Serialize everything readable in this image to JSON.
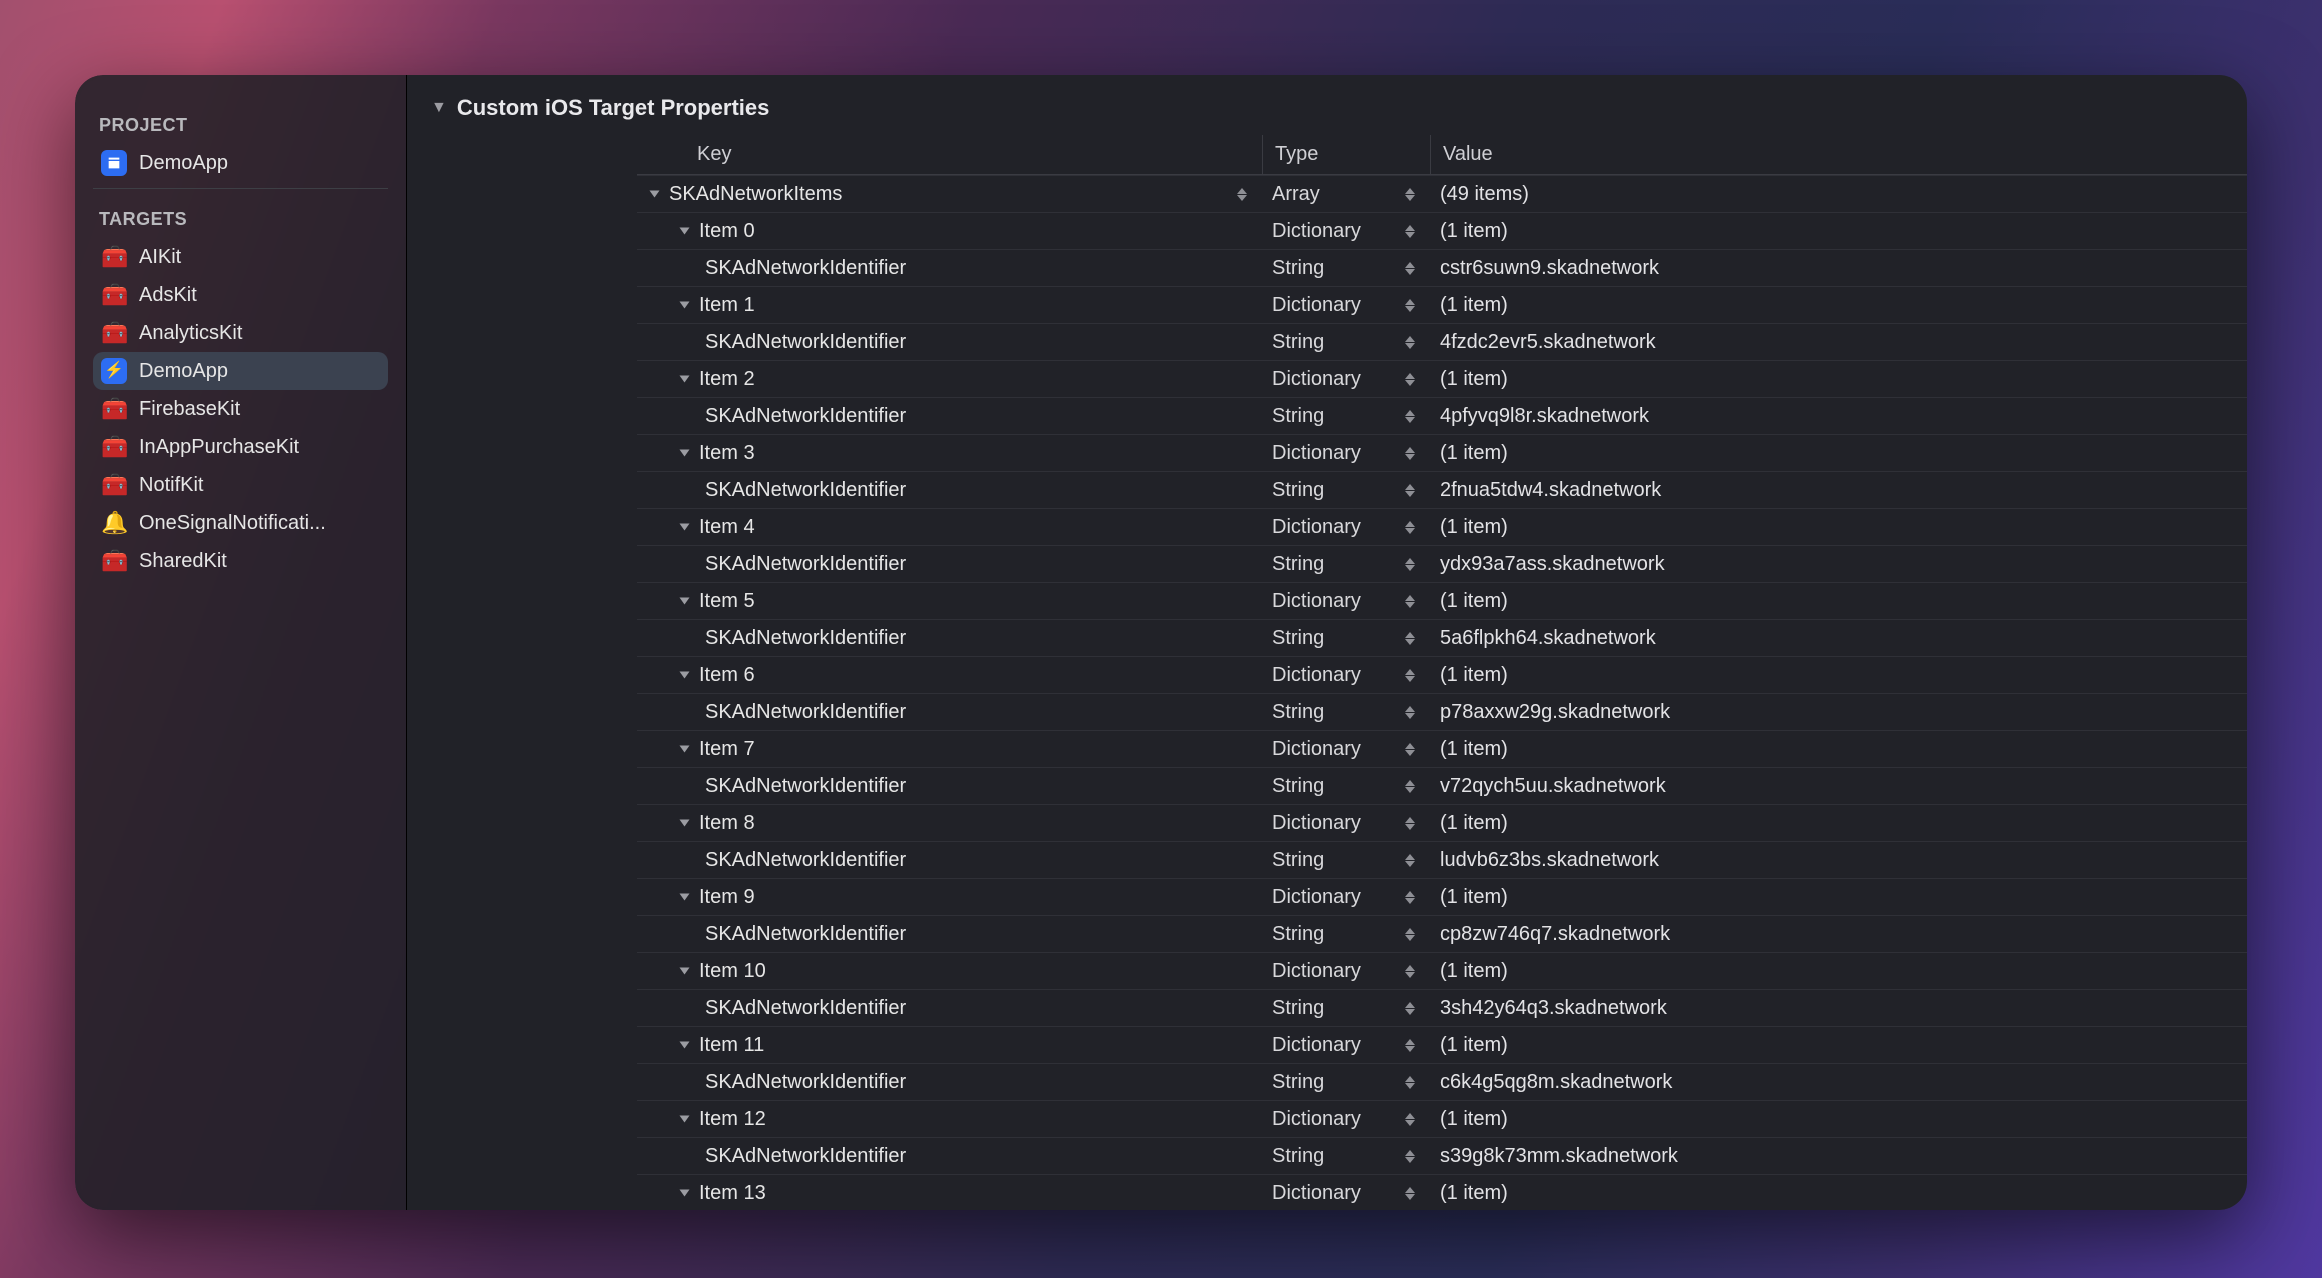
{
  "sidebar": {
    "sections": {
      "project": {
        "title": "PROJECT"
      },
      "targets": {
        "title": "TARGETS"
      }
    },
    "project_item": {
      "label": "DemoApp"
    },
    "targets": [
      {
        "label": "AIKit",
        "icon": "🧰"
      },
      {
        "label": "AdsKit",
        "icon": "🧰"
      },
      {
        "label": "AnalyticsKit",
        "icon": "🧰"
      },
      {
        "label": "DemoApp",
        "icon": "⚡",
        "selected": true
      },
      {
        "label": "FirebaseKit",
        "icon": "🧰"
      },
      {
        "label": "InAppPurchaseKit",
        "icon": "🧰"
      },
      {
        "label": "NotifKit",
        "icon": "🧰"
      },
      {
        "label": "OneSignalNotificati...",
        "icon": "🔔"
      },
      {
        "label": "SharedKit",
        "icon": "🧰"
      }
    ]
  },
  "properties": {
    "title": "Custom iOS Target Properties",
    "columns": {
      "key": "Key",
      "type": "Type",
      "value": "Value"
    },
    "root": {
      "key": "SKAdNetworkItems",
      "type": "Array",
      "value": "(49 items)"
    },
    "child_key": "SKAdNetworkIdentifier",
    "child_type": "String",
    "item_type": "Dictionary",
    "item_value": "(1 item)",
    "items": [
      {
        "label": "Item 0",
        "id_value": "cstr6suwn9.skadnetwork"
      },
      {
        "label": "Item 1",
        "id_value": "4fzdc2evr5.skadnetwork"
      },
      {
        "label": "Item 2",
        "id_value": "4pfyvq9l8r.skadnetwork"
      },
      {
        "label": "Item 3",
        "id_value": "2fnua5tdw4.skadnetwork"
      },
      {
        "label": "Item 4",
        "id_value": "ydx93a7ass.skadnetwork"
      },
      {
        "label": "Item 5",
        "id_value": "5a6flpkh64.skadnetwork"
      },
      {
        "label": "Item 6",
        "id_value": "p78axxw29g.skadnetwork"
      },
      {
        "label": "Item 7",
        "id_value": "v72qych5uu.skadnetwork"
      },
      {
        "label": "Item 8",
        "id_value": "ludvb6z3bs.skadnetwork"
      },
      {
        "label": "Item 9",
        "id_value": "cp8zw746q7.skadnetwork"
      },
      {
        "label": "Item 10",
        "id_value": "3sh42y64q3.skadnetwork"
      },
      {
        "label": "Item 11",
        "id_value": "c6k4g5qg8m.skadnetwork"
      },
      {
        "label": "Item 12",
        "id_value": "s39g8k73mm.skadnetwork"
      }
    ],
    "trailing_item": {
      "label": "Item 13"
    }
  }
}
